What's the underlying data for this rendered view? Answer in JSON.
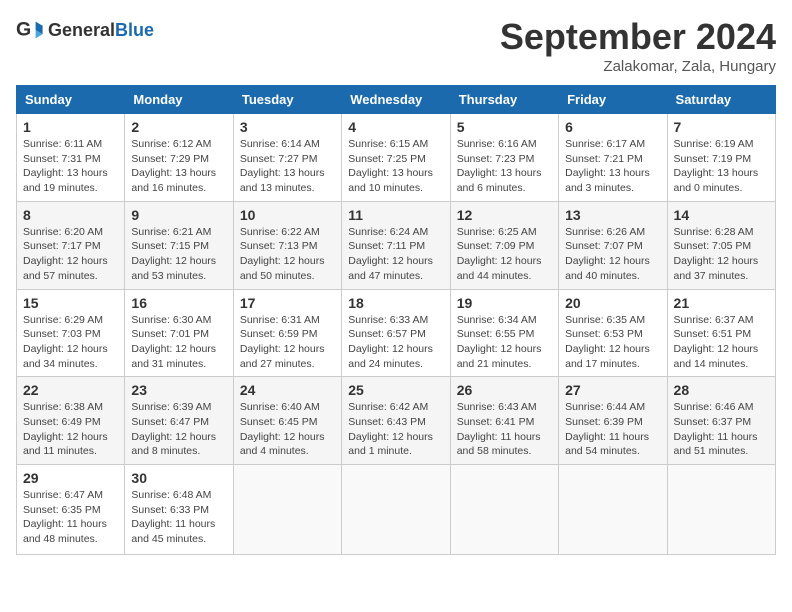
{
  "header": {
    "logo_general": "General",
    "logo_blue": "Blue",
    "month_title": "September 2024",
    "location": "Zalakomar, Zala, Hungary"
  },
  "weekdays": [
    "Sunday",
    "Monday",
    "Tuesday",
    "Wednesday",
    "Thursday",
    "Friday",
    "Saturday"
  ],
  "weeks": [
    [
      {
        "day": "1",
        "sunrise": "6:11 AM",
        "sunset": "7:31 PM",
        "daylight": "13 hours and 19 minutes"
      },
      {
        "day": "2",
        "sunrise": "6:12 AM",
        "sunset": "7:29 PM",
        "daylight": "13 hours and 16 minutes"
      },
      {
        "day": "3",
        "sunrise": "6:14 AM",
        "sunset": "7:27 PM",
        "daylight": "13 hours and 13 minutes"
      },
      {
        "day": "4",
        "sunrise": "6:15 AM",
        "sunset": "7:25 PM",
        "daylight": "13 hours and 10 minutes"
      },
      {
        "day": "5",
        "sunrise": "6:16 AM",
        "sunset": "7:23 PM",
        "daylight": "13 hours and 6 minutes"
      },
      {
        "day": "6",
        "sunrise": "6:17 AM",
        "sunset": "7:21 PM",
        "daylight": "13 hours and 3 minutes"
      },
      {
        "day": "7",
        "sunrise": "6:19 AM",
        "sunset": "7:19 PM",
        "daylight": "13 hours and 0 minutes"
      }
    ],
    [
      {
        "day": "8",
        "sunrise": "6:20 AM",
        "sunset": "7:17 PM",
        "daylight": "12 hours and 57 minutes"
      },
      {
        "day": "9",
        "sunrise": "6:21 AM",
        "sunset": "7:15 PM",
        "daylight": "12 hours and 53 minutes"
      },
      {
        "day": "10",
        "sunrise": "6:22 AM",
        "sunset": "7:13 PM",
        "daylight": "12 hours and 50 minutes"
      },
      {
        "day": "11",
        "sunrise": "6:24 AM",
        "sunset": "7:11 PM",
        "daylight": "12 hours and 47 minutes"
      },
      {
        "day": "12",
        "sunrise": "6:25 AM",
        "sunset": "7:09 PM",
        "daylight": "12 hours and 44 minutes"
      },
      {
        "day": "13",
        "sunrise": "6:26 AM",
        "sunset": "7:07 PM",
        "daylight": "12 hours and 40 minutes"
      },
      {
        "day": "14",
        "sunrise": "6:28 AM",
        "sunset": "7:05 PM",
        "daylight": "12 hours and 37 minutes"
      }
    ],
    [
      {
        "day": "15",
        "sunrise": "6:29 AM",
        "sunset": "7:03 PM",
        "daylight": "12 hours and 34 minutes"
      },
      {
        "day": "16",
        "sunrise": "6:30 AM",
        "sunset": "7:01 PM",
        "daylight": "12 hours and 31 minutes"
      },
      {
        "day": "17",
        "sunrise": "6:31 AM",
        "sunset": "6:59 PM",
        "daylight": "12 hours and 27 minutes"
      },
      {
        "day": "18",
        "sunrise": "6:33 AM",
        "sunset": "6:57 PM",
        "daylight": "12 hours and 24 minutes"
      },
      {
        "day": "19",
        "sunrise": "6:34 AM",
        "sunset": "6:55 PM",
        "daylight": "12 hours and 21 minutes"
      },
      {
        "day": "20",
        "sunrise": "6:35 AM",
        "sunset": "6:53 PM",
        "daylight": "12 hours and 17 minutes"
      },
      {
        "day": "21",
        "sunrise": "6:37 AM",
        "sunset": "6:51 PM",
        "daylight": "12 hours and 14 minutes"
      }
    ],
    [
      {
        "day": "22",
        "sunrise": "6:38 AM",
        "sunset": "6:49 PM",
        "daylight": "12 hours and 11 minutes"
      },
      {
        "day": "23",
        "sunrise": "6:39 AM",
        "sunset": "6:47 PM",
        "daylight": "12 hours and 8 minutes"
      },
      {
        "day": "24",
        "sunrise": "6:40 AM",
        "sunset": "6:45 PM",
        "daylight": "12 hours and 4 minutes"
      },
      {
        "day": "25",
        "sunrise": "6:42 AM",
        "sunset": "6:43 PM",
        "daylight": "12 hours and 1 minute"
      },
      {
        "day": "26",
        "sunrise": "6:43 AM",
        "sunset": "6:41 PM",
        "daylight": "11 hours and 58 minutes"
      },
      {
        "day": "27",
        "sunrise": "6:44 AM",
        "sunset": "6:39 PM",
        "daylight": "11 hours and 54 minutes"
      },
      {
        "day": "28",
        "sunrise": "6:46 AM",
        "sunset": "6:37 PM",
        "daylight": "11 hours and 51 minutes"
      }
    ],
    [
      {
        "day": "29",
        "sunrise": "6:47 AM",
        "sunset": "6:35 PM",
        "daylight": "11 hours and 48 minutes"
      },
      {
        "day": "30",
        "sunrise": "6:48 AM",
        "sunset": "6:33 PM",
        "daylight": "11 hours and 45 minutes"
      },
      null,
      null,
      null,
      null,
      null
    ]
  ]
}
